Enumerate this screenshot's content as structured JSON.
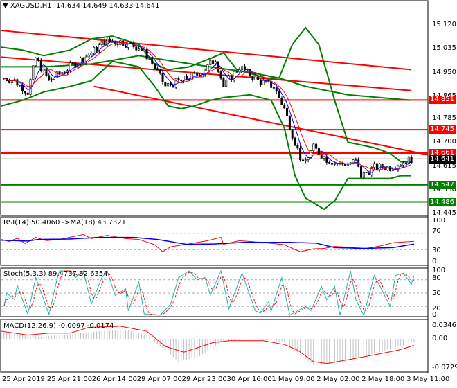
{
  "header": {
    "symbol": "XAGUSD,H1",
    "open": "14.634",
    "high": "14.649",
    "low": "14.633",
    "close": "14.641"
  },
  "price_axis": {
    "ticks": [
      "15.120",
      "15.035",
      "14.950",
      "14.865",
      "14.785",
      "14.700",
      "14.615",
      "14.530",
      "14.445"
    ],
    "levels": [
      {
        "label": "14.851",
        "color": "#ff0000"
      },
      {
        "label": "14.745",
        "color": "#ff0000"
      },
      {
        "label": "14.661",
        "color": "#ff0000"
      },
      {
        "label": "14.547",
        "color": "#008000"
      },
      {
        "label": "14.486",
        "color": "#008000"
      }
    ],
    "current": {
      "label": "14.641",
      "color": "#000000"
    }
  },
  "rsi": {
    "title": "RSI(14) 50.4060  ->MA(18) 43.7321",
    "ticks": [
      "100",
      "70",
      "30",
      "0"
    ]
  },
  "stoch": {
    "title": "Stoch(5,3,3) 89.4737 82.6354",
    "ticks": [
      "100",
      "80",
      "50",
      "20",
      "0"
    ]
  },
  "macd": {
    "title": "MACD(12,26,9) -0.0097 -0.0174",
    "ticks": [
      "0.0346",
      "0.00",
      "-0.0729"
    ]
  },
  "time_axis": [
    "25 Apr 2019",
    "25 Apr 21:00",
    "26 Apr 14:00",
    "29 Apr 07:00",
    "29 Apr 23:00",
    "30 Apr 16:00",
    "1 May 09:00",
    "2 May 02:00",
    "2 May 18:00",
    "3 May 11:00"
  ],
  "colors": {
    "band": "#008000",
    "trend": "#ff0000",
    "rsi": "#ff0000",
    "rsi_ma": "#0000ff",
    "stoch_main": "#20b2aa",
    "stoch_signal": "#ff0000",
    "macd_hist": "#c0c0c0",
    "macd_signal": "#ff0000"
  },
  "chart_data": {
    "type": "candlestick",
    "close_path": [
      [
        1,
        14.93
      ],
      [
        5,
        14.92
      ],
      [
        10,
        14.88
      ],
      [
        13,
        15.0
      ],
      [
        18,
        14.92
      ],
      [
        26,
        14.97
      ],
      [
        34,
        15.02
      ],
      [
        39,
        15.06
      ],
      [
        45,
        15.06
      ],
      [
        52,
        15.04
      ],
      [
        56,
        15.0
      ],
      [
        62,
        14.9
      ],
      [
        68,
        14.92
      ],
      [
        76,
        14.95
      ],
      [
        81,
        15.0
      ],
      [
        84,
        14.9
      ],
      [
        90,
        14.97
      ],
      [
        97,
        14.92
      ],
      [
        103,
        14.9
      ],
      [
        107,
        14.82
      ],
      [
        111,
        14.7
      ],
      [
        114,
        14.62
      ],
      [
        118,
        14.68
      ],
      [
        123,
        14.64
      ],
      [
        128,
        14.62
      ],
      [
        134,
        14.63
      ],
      [
        136,
        14.58
      ],
      [
        141,
        14.61
      ],
      [
        147,
        14.61
      ],
      [
        155,
        14.641
      ]
    ],
    "bb_upper": [
      [
        0,
        15.04
      ],
      [
        8,
        15.03
      ],
      [
        16,
        15.01
      ],
      [
        26,
        15.03
      ],
      [
        34,
        15.07
      ],
      [
        42,
        15.08
      ],
      [
        52,
        15.05
      ],
      [
        58,
        14.98
      ],
      [
        63,
        14.96
      ],
      [
        71,
        14.97
      ],
      [
        79,
        15.0
      ],
      [
        84,
        15.02
      ],
      [
        89,
        14.96
      ],
      [
        100,
        14.93
      ],
      [
        105,
        14.93
      ],
      [
        110,
        15.05
      ],
      [
        115,
        15.11
      ],
      [
        120,
        15.05
      ],
      [
        126,
        14.85
      ],
      [
        131,
        14.7
      ],
      [
        136,
        14.69
      ],
      [
        141,
        14.68
      ],
      [
        147,
        14.66
      ],
      [
        151,
        14.63
      ],
      [
        155,
        14.63
      ]
    ],
    "bb_lower": [
      [
        0,
        14.83
      ],
      [
        8,
        14.85
      ],
      [
        16,
        14.88
      ],
      [
        26,
        14.9
      ],
      [
        34,
        14.92
      ],
      [
        42,
        14.99
      ],
      [
        52,
        14.97
      ],
      [
        58,
        14.9
      ],
      [
        63,
        14.83
      ],
      [
        68,
        14.82
      ],
      [
        73,
        14.83
      ],
      [
        79,
        14.85
      ],
      [
        84,
        14.86
      ],
      [
        94,
        14.87
      ],
      [
        102,
        14.85
      ],
      [
        107,
        14.75
      ],
      [
        111,
        14.58
      ],
      [
        115,
        14.5
      ],
      [
        122,
        14.46
      ],
      [
        126,
        14.49
      ],
      [
        131,
        14.57
      ],
      [
        136,
        14.57
      ],
      [
        147,
        14.57
      ],
      [
        151,
        14.58
      ],
      [
        155,
        14.58
      ]
    ],
    "bb_middle": [
      [
        0,
        14.97
      ],
      [
        16,
        14.97
      ],
      [
        34,
        14.98
      ],
      [
        52,
        15.01
      ],
      [
        65,
        14.99
      ],
      [
        79,
        14.97
      ],
      [
        94,
        14.95
      ],
      [
        105,
        14.93
      ],
      [
        115,
        14.9
      ],
      [
        131,
        14.87
      ],
      [
        155,
        14.85
      ]
    ],
    "trendlines": [
      [
        [
          0,
          15.1
        ],
        [
          155,
          14.96
        ]
      ],
      [
        [
          0,
          15.005
        ],
        [
          155,
          14.885
        ]
      ],
      [
        [
          35,
          14.9
        ],
        [
          162,
          14.655
        ]
      ]
    ],
    "rsi": [
      [
        0,
        55
      ],
      [
        3,
        50
      ],
      [
        6,
        58
      ],
      [
        9,
        45
      ],
      [
        13,
        60
      ],
      [
        17,
        52
      ],
      [
        22,
        55
      ],
      [
        31,
        67
      ],
      [
        34,
        57
      ],
      [
        40,
        65
      ],
      [
        47,
        57
      ],
      [
        52,
        55
      ],
      [
        58,
        42
      ],
      [
        61,
        25
      ],
      [
        64,
        37
      ],
      [
        69,
        42
      ],
      [
        78,
        52
      ],
      [
        83,
        60
      ],
      [
        84,
        43
      ],
      [
        90,
        52
      ],
      [
        100,
        47
      ],
      [
        107,
        42
      ],
      [
        110,
        33
      ],
      [
        113,
        25
      ],
      [
        118,
        32
      ],
      [
        122,
        33
      ],
      [
        126,
        38
      ],
      [
        133,
        35
      ],
      [
        138,
        33
      ],
      [
        144,
        40
      ],
      [
        148,
        47
      ],
      [
        156,
        50.4
      ]
    ],
    "rsi_ma": [
      [
        0,
        53
      ],
      [
        10,
        51
      ],
      [
        14,
        55
      ],
      [
        26,
        56
      ],
      [
        37,
        60
      ],
      [
        50,
        60
      ],
      [
        59,
        55
      ],
      [
        70,
        43
      ],
      [
        81,
        44
      ],
      [
        92,
        48
      ],
      [
        108,
        48
      ],
      [
        119,
        46
      ],
      [
        126,
        35
      ],
      [
        137,
        33
      ],
      [
        148,
        35
      ],
      [
        156,
        43.7
      ]
    ],
    "stoch": [
      [
        1,
        20
      ],
      [
        2,
        50
      ],
      [
        5,
        35
      ],
      [
        6,
        68
      ],
      [
        10,
        2
      ],
      [
        13,
        85
      ],
      [
        18,
        2
      ],
      [
        21,
        80
      ],
      [
        22,
        100
      ],
      [
        26,
        100
      ],
      [
        28,
        85
      ],
      [
        31,
        100
      ],
      [
        34,
        25
      ],
      [
        38,
        85
      ],
      [
        40,
        100
      ],
      [
        43,
        45
      ],
      [
        47,
        60
      ],
      [
        48,
        10
      ],
      [
        52,
        75
      ],
      [
        54,
        3
      ],
      [
        60,
        0
      ],
      [
        64,
        25
      ],
      [
        67,
        85
      ],
      [
        71,
        100
      ],
      [
        74,
        80
      ],
      [
        77,
        85
      ],
      [
        79,
        45
      ],
      [
        83,
        100
      ],
      [
        86,
        15
      ],
      [
        91,
        95
      ],
      [
        96,
        10
      ],
      [
        98,
        5
      ],
      [
        101,
        30
      ],
      [
        102,
        10
      ],
      [
        106,
        85
      ],
      [
        109,
        0
      ],
      [
        115,
        20
      ],
      [
        117,
        10
      ],
      [
        121,
        65
      ],
      [
        123,
        35
      ],
      [
        126,
        65
      ],
      [
        128,
        0
      ],
      [
        132,
        100
      ],
      [
        134,
        35
      ],
      [
        137,
        0
      ],
      [
        141,
        90
      ],
      [
        147,
        20
      ],
      [
        149,
        90
      ],
      [
        152,
        95
      ],
      [
        155,
        70
      ],
      [
        156,
        89.5
      ]
    ],
    "macd_hist": [
      [
        0,
        0.015
      ],
      [
        10,
        0.01
      ],
      [
        14,
        0.005
      ],
      [
        26,
        0.012
      ],
      [
        40,
        0.022
      ],
      [
        48,
        0.022
      ],
      [
        55,
        0.01
      ],
      [
        62,
        -0.03
      ],
      [
        67,
        -0.06
      ],
      [
        75,
        -0.045
      ],
      [
        83,
        -0.01
      ],
      [
        92,
        0.0
      ],
      [
        100,
        -0.002
      ],
      [
        107,
        -0.01
      ],
      [
        113,
        -0.04
      ],
      [
        118,
        -0.07
      ],
      [
        125,
        -0.065
      ],
      [
        135,
        -0.05
      ],
      [
        145,
        -0.03
      ],
      [
        156,
        -0.0097
      ]
    ],
    "macd_signal": [
      [
        0,
        0.02
      ],
      [
        10,
        0.01
      ],
      [
        18,
        0.015
      ],
      [
        26,
        0.015
      ],
      [
        33,
        0.03
      ],
      [
        45,
        0.033
      ],
      [
        55,
        0.02
      ],
      [
        62,
        -0.02
      ],
      [
        69,
        -0.035
      ],
      [
        80,
        -0.01
      ],
      [
        86,
        -0.005
      ],
      [
        99,
        -0.005
      ],
      [
        107,
        -0.015
      ],
      [
        112,
        -0.03
      ],
      [
        118,
        -0.06
      ],
      [
        123,
        -0.065
      ],
      [
        135,
        -0.05
      ],
      [
        150,
        -0.03
      ],
      [
        156,
        -0.0174
      ]
    ]
  }
}
